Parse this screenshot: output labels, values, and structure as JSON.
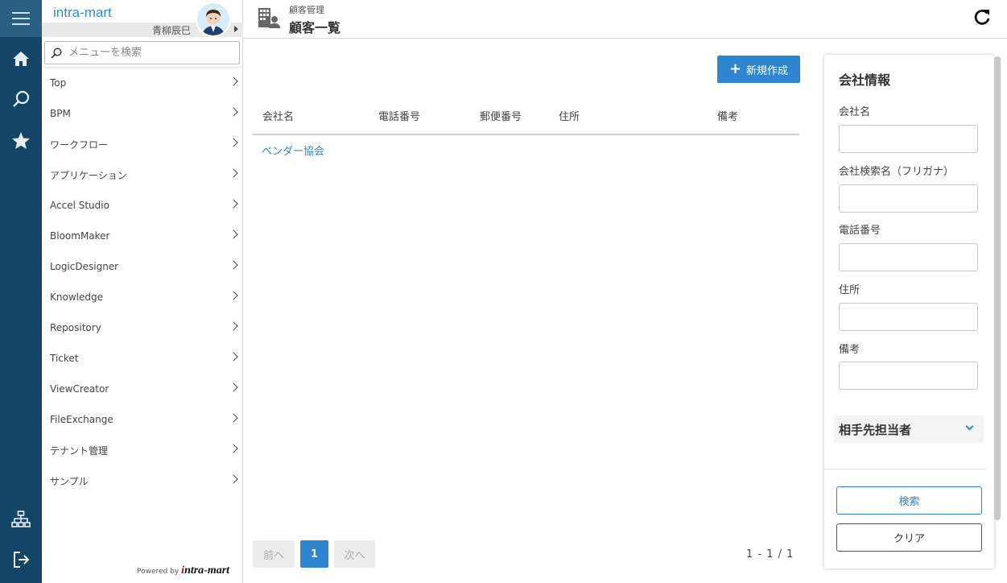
{
  "brand": {
    "name": "intra-mart"
  },
  "user": {
    "name": "青柳辰巳"
  },
  "search": {
    "placeholder": "メニューを検索"
  },
  "menu": {
    "items": [
      {
        "label": "Top"
      },
      {
        "label": "BPM"
      },
      {
        "label": "ワークフロー"
      },
      {
        "label": "アプリケーション"
      },
      {
        "label": "Accel Studio"
      },
      {
        "label": "BloomMaker"
      },
      {
        "label": "LogicDesigner"
      },
      {
        "label": "Knowledge"
      },
      {
        "label": "Repository"
      },
      {
        "label": "Ticket"
      },
      {
        "label": "ViewCreator"
      },
      {
        "label": "FileExchange"
      },
      {
        "label": "テナント管理"
      },
      {
        "label": "サンプル"
      }
    ]
  },
  "powered": {
    "by": "Powered by",
    "logo_first": "i",
    "logo_rest": "ntra-mart"
  },
  "header": {
    "breadcrumb": "顧客管理",
    "title": "顧客一覧"
  },
  "toolbar": {
    "new_label": "新規作成",
    "new_icon": "plus-icon"
  },
  "table": {
    "headers": [
      "会社名",
      "電話番号",
      "郵便番号",
      "住所",
      "備考"
    ],
    "rows": [
      {
        "company": "ベンダー協会"
      }
    ]
  },
  "pagination": {
    "prev": "前へ",
    "current": "1",
    "next": "次へ",
    "info": "1 -  1 / 1"
  },
  "panel": {
    "title": "会社情報",
    "fields": [
      {
        "label": "会社名",
        "value": ""
      },
      {
        "label": "会社検索名（フリガナ）",
        "value": ""
      },
      {
        "label": "電話番号",
        "value": ""
      },
      {
        "label": "住所",
        "value": ""
      },
      {
        "label": "備考",
        "value": ""
      }
    ],
    "section_title": "相手先担当者",
    "search_label": "検索",
    "clear_label": "クリア"
  },
  "colors": {
    "rail": "#154566",
    "accent": "#2f85d0",
    "brand": "#2f8ad7"
  }
}
